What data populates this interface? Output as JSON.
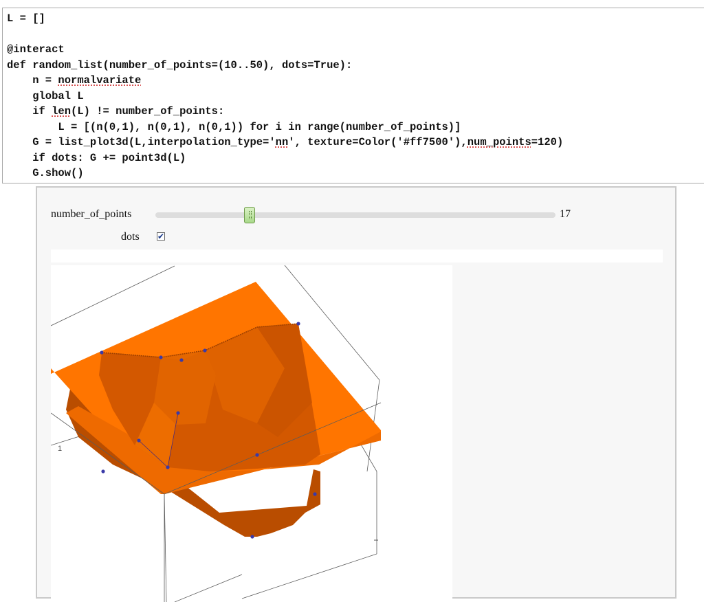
{
  "code_cell": {
    "lines": [
      {
        "segments": [
          {
            "text": "L = []"
          }
        ]
      },
      {
        "segments": [
          {
            "text": ""
          }
        ]
      },
      {
        "segments": [
          {
            "text": "@interact"
          }
        ]
      },
      {
        "segments": [
          {
            "text": "def random_list(number_of_points=(10..50), dots=True):"
          }
        ]
      },
      {
        "segments": [
          {
            "text": "    n = "
          },
          {
            "text": "normalvariate",
            "squiggle": true
          }
        ]
      },
      {
        "segments": [
          {
            "text": "    global L"
          }
        ]
      },
      {
        "segments": [
          {
            "text": "    if "
          },
          {
            "text": "len",
            "squiggle": true
          },
          {
            "text": "(L) != number_of_points:"
          }
        ]
      },
      {
        "segments": [
          {
            "text": "        L = [(n(0,1), n(0,1), n(0,1)) for i in range(number_of_points)]"
          }
        ]
      },
      {
        "segments": [
          {
            "text": "    G = list_plot3d(L,interpolation_type='"
          },
          {
            "text": "nn",
            "squiggle": true
          },
          {
            "text": "', texture=Color('#ff7500'),"
          },
          {
            "text": "num_points",
            "squiggle": true
          },
          {
            "text": "=120)"
          }
        ]
      },
      {
        "segments": [
          {
            "text": "    if dots: G += point3d(L)"
          }
        ]
      },
      {
        "segments": [
          {
            "text": "    G.show()"
          }
        ]
      }
    ]
  },
  "interact": {
    "slider_label": "number_of_points",
    "slider_value": "17",
    "slider_min": 10,
    "slider_max": 50,
    "checkbox_label": "dots",
    "checkbox_checked": true,
    "checkbox_glyph": "✔"
  },
  "plot": {
    "surface_color": "#ff7500",
    "surface_dark": "#d65a00",
    "surface_darker": "#b94d00",
    "point_color": "#3a3aa8",
    "axis_tick_label": "1"
  }
}
